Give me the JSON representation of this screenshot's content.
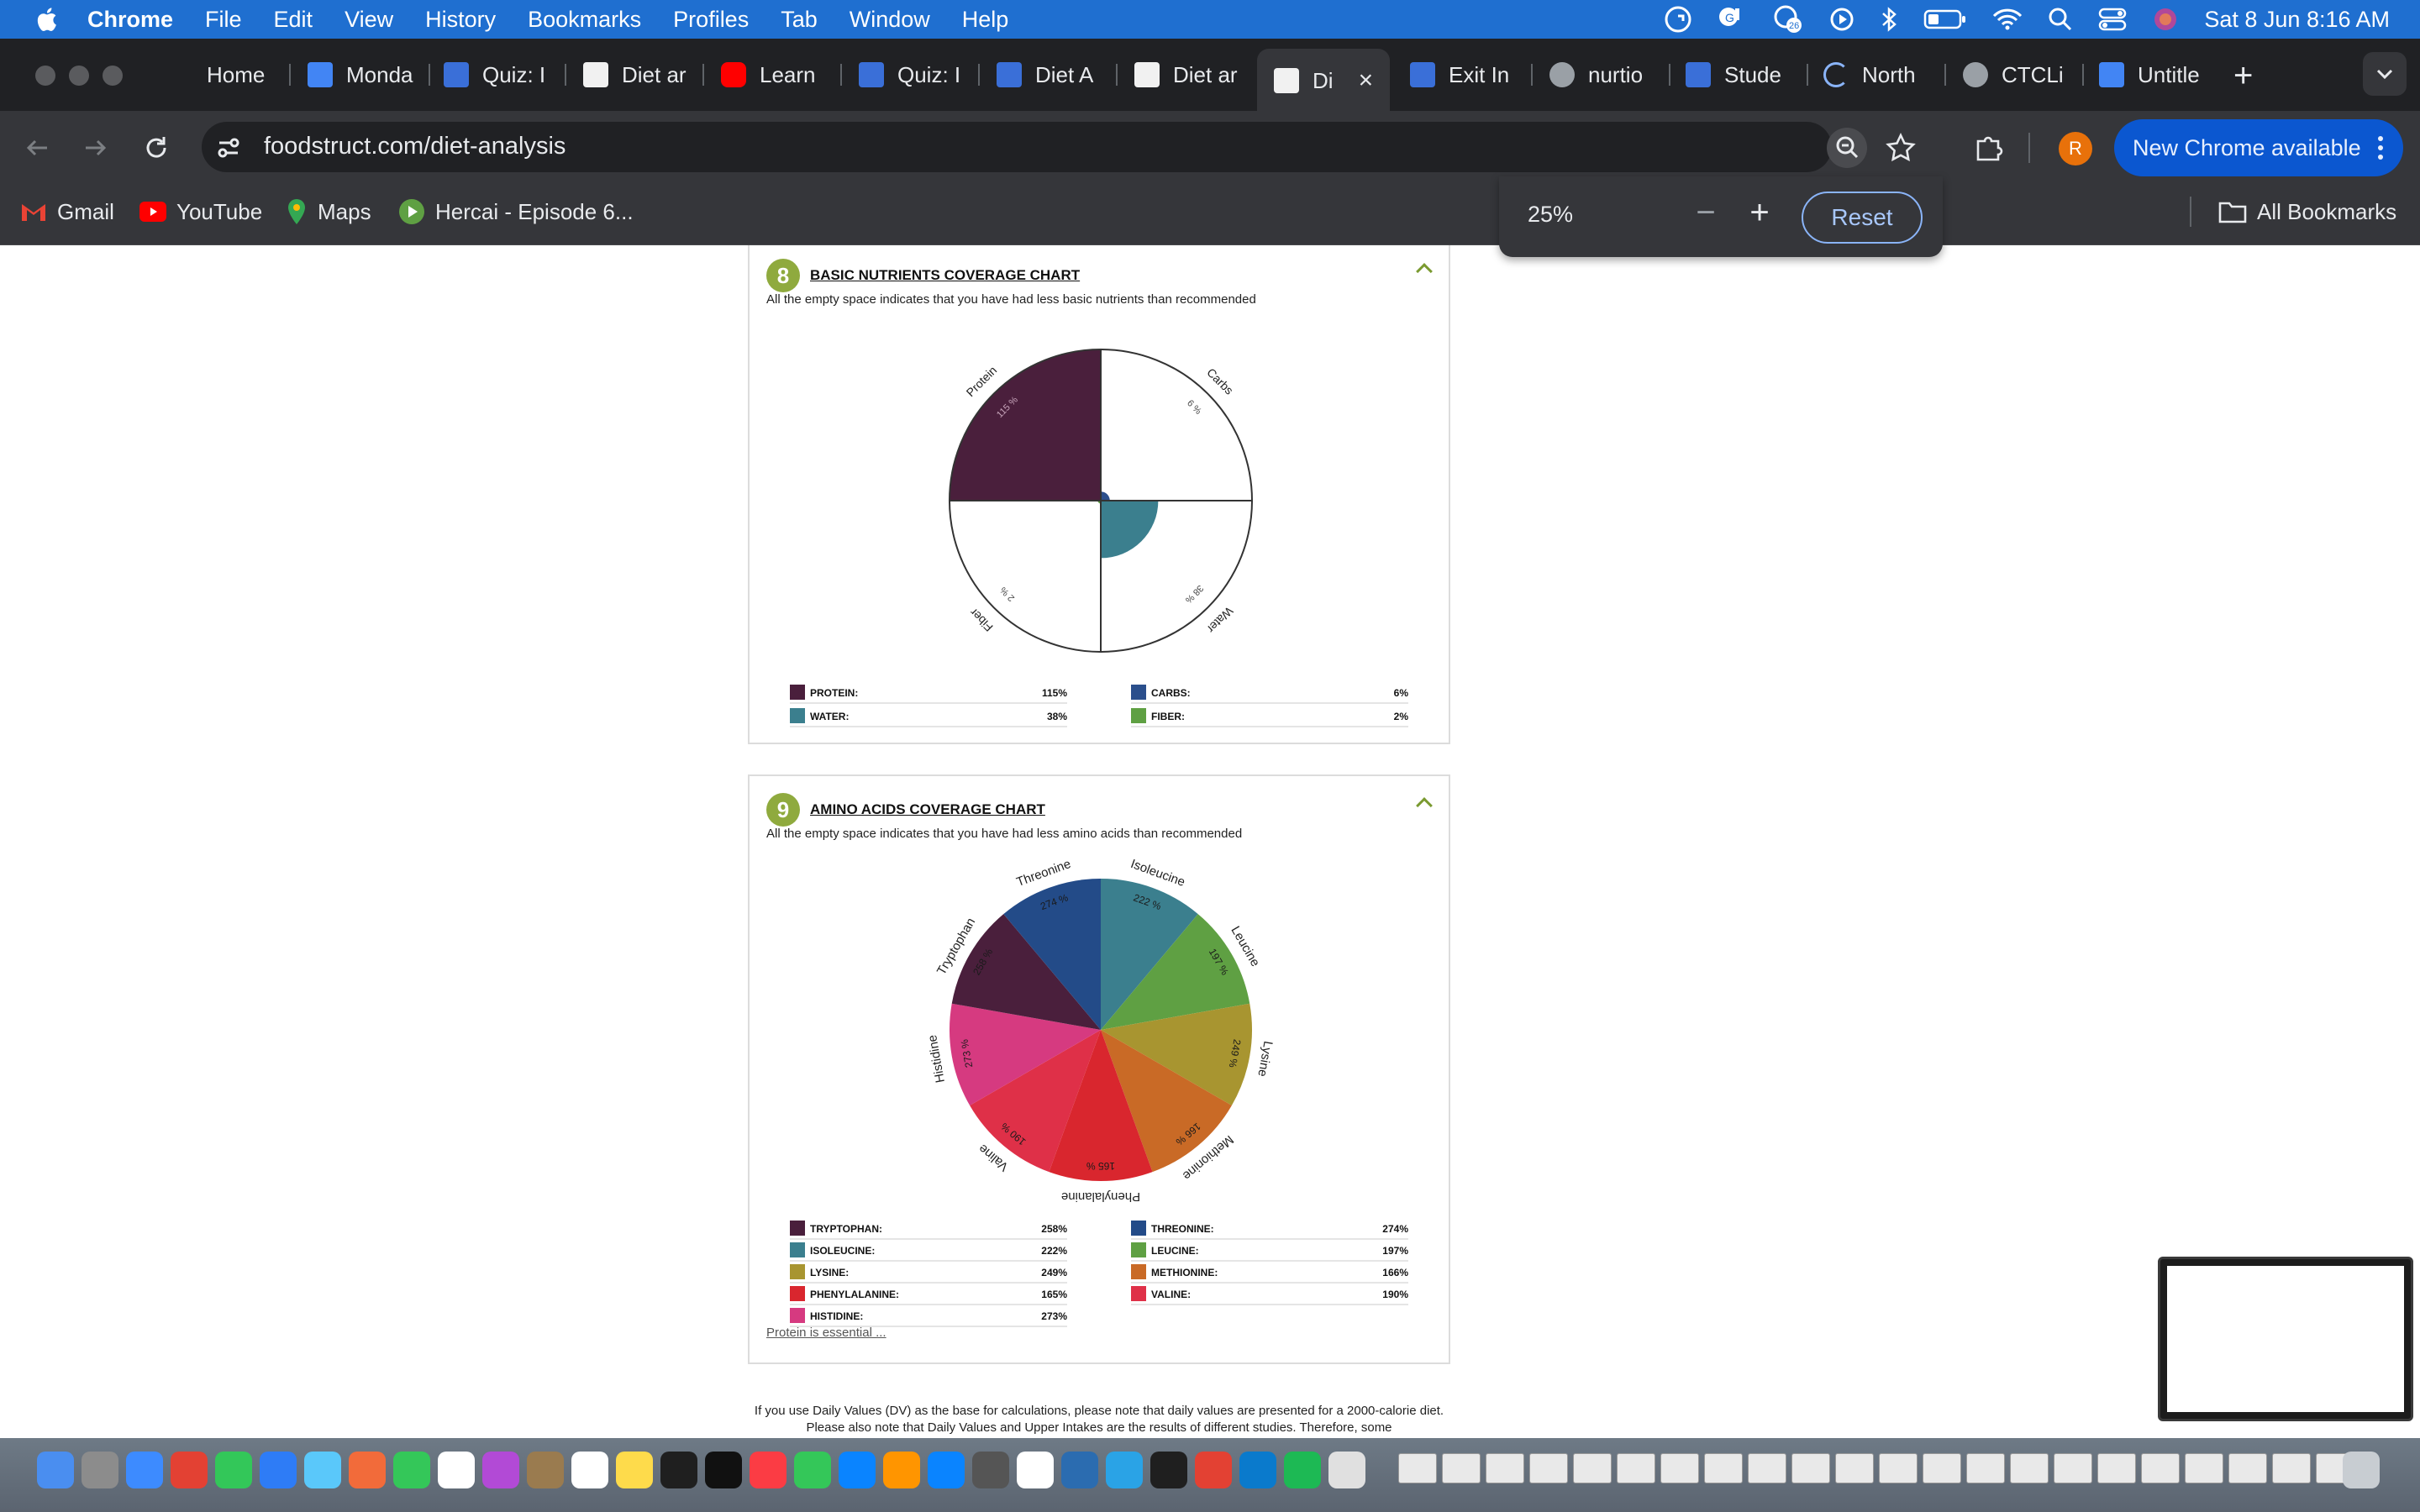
{
  "menubar": {
    "app": "Chrome",
    "items": [
      "File",
      "Edit",
      "View",
      "History",
      "Bookmarks",
      "Profiles",
      "Tab",
      "Window",
      "Help"
    ],
    "notification_count": "26",
    "datetime": "Sat 8 Jun  8:16 AM"
  },
  "tabs": [
    {
      "label": "Home",
      "icon": "none"
    },
    {
      "label": "Monda",
      "icon": "docs-icon"
    },
    {
      "label": "Quiz: I",
      "icon": "canvas-icon"
    },
    {
      "label": "Diet ar",
      "icon": "foodstruct-icon"
    },
    {
      "label": "Learn",
      "icon": "youtube-icon"
    },
    {
      "label": "Quiz: I",
      "icon": "canvas-icon"
    },
    {
      "label": "Diet A",
      "icon": "canvas-icon"
    },
    {
      "label": "Diet ar",
      "icon": "foodstruct-icon"
    },
    {
      "label": "Di",
      "icon": "foodstruct-icon",
      "active": true
    },
    {
      "label": "Exit In",
      "icon": "canvas-icon"
    },
    {
      "label": "nurtio",
      "icon": "globe-icon"
    },
    {
      "label": "Stude",
      "icon": "canvas-icon"
    },
    {
      "label": "North",
      "icon": "loading-icon"
    },
    {
      "label": "CTCLi",
      "icon": "globe-icon"
    },
    {
      "label": "Untitle",
      "icon": "docs-icon"
    }
  ],
  "address": {
    "url": "foodstruct.com/diet-analysis"
  },
  "profile_initial": "R",
  "new_chrome_label": "New Chrome available",
  "bookmarks": [
    {
      "label": "Gmail",
      "icon": "gmail-icon"
    },
    {
      "label": "YouTube",
      "icon": "youtube-icon"
    },
    {
      "label": "Maps",
      "icon": "maps-icon"
    },
    {
      "label": "Hercai - Episode 6...",
      "icon": "play-icon"
    }
  ],
  "all_bookmarks_label": "All Bookmarks",
  "zoom": {
    "value": "25%",
    "minus": "−",
    "plus": "+",
    "reset_label": "Reset"
  },
  "section8": {
    "number": "8",
    "title": "BASIC NUTRIENTS COVERAGE CHART",
    "subtitle": "All the empty space indicates that you have had less basic nutrients than recommended"
  },
  "section9": {
    "number": "9",
    "title": "AMINO ACIDS COVERAGE CHART",
    "subtitle": "All the empty space indicates that you have had less amino acids than recommended",
    "more_link": "Protein is essential ..."
  },
  "footnote": "If you use Daily Values (DV) as the base for calculations, please note that daily values are presented for a 2000-calorie diet. Please also note that Daily Values and Upper Intakes are the results of different studies. Therefore, some",
  "chart_data": [
    {
      "type": "pie",
      "subtype": "polar-area",
      "title": "BASIC NUTRIENTS COVERAGE CHART",
      "categories": [
        "Carbs",
        "Water",
        "Fiber",
        "Protein"
      ],
      "values": [
        6,
        38,
        2,
        115
      ],
      "value_labels": [
        "6 %",
        "38 %",
        "2 %",
        "115 %"
      ],
      "colors": [
        "#2b4f8c",
        "#3b7f8e",
        "#5fa043",
        "#4a1f3c"
      ],
      "rmax": 100,
      "legend": [
        {
          "name": "PROTEIN:",
          "value": "115%",
          "color": "#4a1f3c"
        },
        {
          "name": "CARBS:",
          "value": "6%",
          "color": "#2b4f8c"
        },
        {
          "name": "WATER:",
          "value": "38%",
          "color": "#3b7f8e"
        },
        {
          "name": "FIBER:",
          "value": "2%",
          "color": "#5fa043"
        }
      ]
    },
    {
      "type": "pie",
      "subtype": "polar-area",
      "title": "AMINO ACIDS COVERAGE CHART",
      "categories": [
        "Isoleucine",
        "Leucine",
        "Lysine",
        "Methionine",
        "Phenylalanine",
        "Valine",
        "Histidine",
        "Tryptophan",
        "Threonine"
      ],
      "values": [
        222,
        197,
        249,
        166,
        165,
        190,
        273,
        258,
        274
      ],
      "value_labels": [
        "222 %",
        "197 %",
        "249 %",
        "166 %",
        "165 %",
        "190 %",
        "273 %",
        "258 %",
        "274 %"
      ],
      "colors": [
        "#3b7f8e",
        "#5fa043",
        "#a89530",
        "#c96a26",
        "#d9262e",
        "#df3048",
        "#d63a80",
        "#4a1f3c",
        "#234b88"
      ],
      "legend": [
        {
          "name": "TRYPTOPHAN:",
          "value": "258%",
          "color": "#4a1f3c"
        },
        {
          "name": "THREONINE:",
          "value": "274%",
          "color": "#234b88"
        },
        {
          "name": "ISOLEUCINE:",
          "value": "222%",
          "color": "#3b7f8e"
        },
        {
          "name": "LEUCINE:",
          "value": "197%",
          "color": "#5fa043"
        },
        {
          "name": "LYSINE:",
          "value": "249%",
          "color": "#a89530"
        },
        {
          "name": "METHIONINE:",
          "value": "166%",
          "color": "#c96a26"
        },
        {
          "name": "PHENYLALANINE:",
          "value": "165%",
          "color": "#d9262e"
        },
        {
          "name": "VALINE:",
          "value": "190%",
          "color": "#df3048"
        },
        {
          "name": "HISTIDINE:",
          "value": "273%",
          "color": "#d63a80"
        }
      ]
    }
  ]
}
